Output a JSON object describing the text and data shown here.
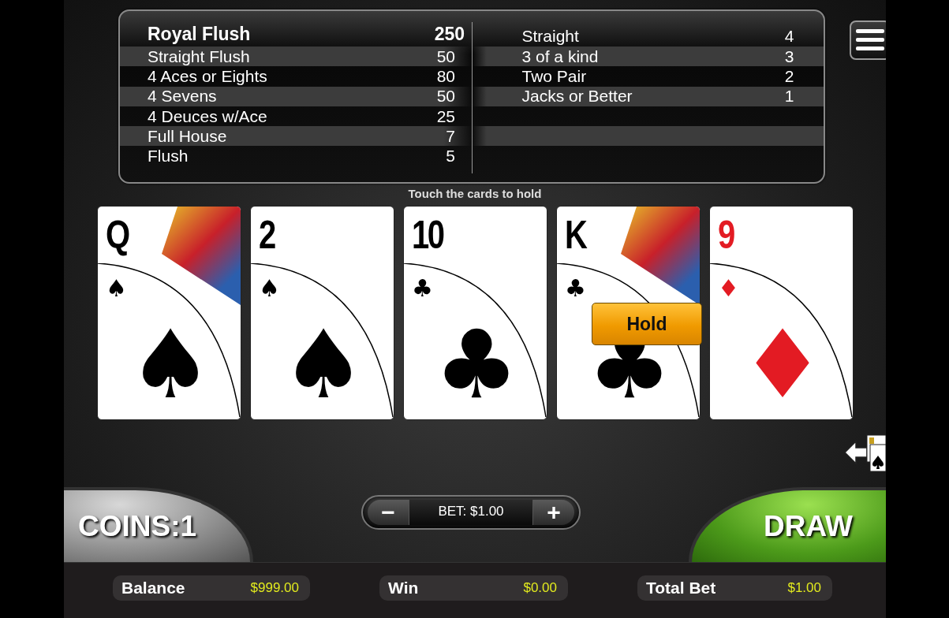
{
  "paytable": {
    "left": [
      {
        "hand": "Royal Flush",
        "payout": "250"
      },
      {
        "hand": "Straight Flush",
        "payout": "50"
      },
      {
        "hand": "4 Aces or Eights",
        "payout": "80"
      },
      {
        "hand": "4 Sevens",
        "payout": "50"
      },
      {
        "hand": "4 Deuces w/Ace",
        "payout": "25"
      },
      {
        "hand": "Full House",
        "payout": "7"
      },
      {
        "hand": "Flush",
        "payout": "5"
      }
    ],
    "right": [
      {
        "hand": "Straight",
        "payout": "4"
      },
      {
        "hand": "3 of a kind",
        "payout": "3"
      },
      {
        "hand": "Two Pair",
        "payout": "2"
      },
      {
        "hand": "Jacks or Better",
        "payout": "1"
      }
    ]
  },
  "hint": "Touch the cards to hold",
  "hold_label": "Hold",
  "cards": [
    {
      "rank": "Q",
      "corner_suit": "♠",
      "center_suit": "♠",
      "color": "#000000",
      "kind": "face",
      "held": false
    },
    {
      "rank": "2",
      "corner_suit": "♠",
      "center_suit": "♠",
      "color": "#000000",
      "kind": "pip",
      "held": false
    },
    {
      "rank": "10",
      "corner_suit": "♣",
      "center_suit": "♣",
      "color": "#000000",
      "kind": "pip",
      "held": false
    },
    {
      "rank": "K",
      "corner_suit": "♣",
      "center_suit": "♣",
      "color": "#000000",
      "kind": "face",
      "held": true
    },
    {
      "rank": "9",
      "corner_suit": "♦",
      "center_suit": "♦",
      "color": "#e31b23",
      "kind": "pip",
      "held": false
    }
  ],
  "coins_button": "COINS:1",
  "bet": {
    "minus": "−",
    "label": "BET: $1.00",
    "plus": "+"
  },
  "draw_button": "DRAW",
  "stats": [
    {
      "label": "Balance",
      "value": "$999.00"
    },
    {
      "label": "Win",
      "value": "$0.00"
    },
    {
      "label": "Total Bet",
      "value": "$1.00"
    }
  ]
}
